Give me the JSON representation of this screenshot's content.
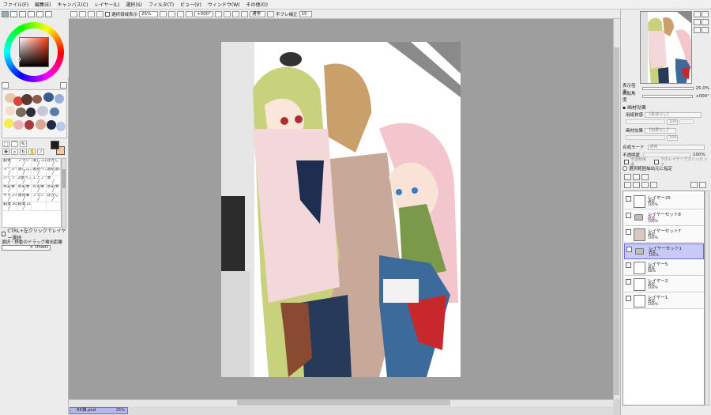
{
  "menu": [
    "ファイル(F)",
    "編集(E)",
    "キャンバス(C)",
    "レイヤー(L)",
    "選択(S)",
    "フィルタ(T)",
    "ビュー(V)",
    "ウィンドウ(W)",
    "その他(O)"
  ],
  "canvas_toolbar": {
    "show_selection_label": "選択領域表示",
    "zoom": "25%",
    "rotation": "+000°",
    "normal_label": "通常",
    "stabilizer_label": "手ブレ補正",
    "stabilizer_value": "15"
  },
  "tools": {
    "brushes": [
      {
        "name": "鉛筆",
        "size": ""
      },
      {
        "name": "ブラシ",
        "size": ""
      },
      {
        "name": "消しゴム",
        "size": ""
      },
      {
        "name": "ぼかし",
        "size": ""
      },
      {
        "name": "マーカー",
        "size": ""
      },
      {
        "name": "消しぶよ",
        "size": ""
      },
      {
        "name": "選択ペン",
        "size": ""
      },
      {
        "name": "選択消し",
        "size": ""
      },
      {
        "name": "バケツ",
        "size": ""
      },
      {
        "name": "2値ペン",
        "size": ""
      },
      {
        "name": "エアブラシ",
        "size": ""
      },
      {
        "name": "筆",
        "size": ""
      },
      {
        "name": "水彩筆",
        "size": "1"
      },
      {
        "name": "水彩筆",
        "size": "100"
      },
      {
        "name": "日本筆",
        "size": ""
      },
      {
        "name": "水彩筆",
        "size": ""
      },
      {
        "name": "キャンバス",
        "size": "1"
      },
      {
        "name": "通常筆",
        "size": "1"
      },
      {
        "name": "ブラシ",
        "size": ""
      },
      {
        "name": "ぼかし",
        "size": ""
      },
      {
        "name": "鉛筆",
        "size": "300"
      },
      {
        "name": "鉛筆",
        "size": "10"
      },
      {
        "name": "",
        "size": ""
      },
      {
        "name": "",
        "size": ""
      }
    ],
    "ctrl_click_label": "CTRL+左クリックでレイヤー選択",
    "drag_threshold_label": "選択・移動のドラッグ検出距離",
    "drag_threshold_value": "± 1Pixels"
  },
  "colors": {
    "foreground": "#201a18",
    "background": "#f2c8a2",
    "workspace": "#9e9e9e"
  },
  "navigator": {
    "zoom_label": "表示倍率",
    "zoom_value": "25.0%",
    "rotation_label": "回転角度",
    "rotation_value": "+000°"
  },
  "texture": {
    "header": "画材効果",
    "paper_label": "用紙質感",
    "paper_value": "【質感なし】",
    "effect_label": "画材効果",
    "effect_value": "【効果なし】",
    "sub_value": "100"
  },
  "layer_props": {
    "blend_label": "合成モード",
    "blend_value": "通常",
    "opacity_label": "不透明度",
    "opacity_value": "100%",
    "preserve_opacity": "不透明保護",
    "clipping": "下のレイヤーでクリッピング",
    "selection_source": "選択範囲抽出元に指定"
  },
  "layers": [
    {
      "name": "レイヤー25",
      "mode": "通常",
      "opacity": "100%",
      "type": "layer",
      "selected": false
    },
    {
      "name": "レイヤーセット8",
      "mode": "通過",
      "opacity": "100%",
      "type": "folder",
      "selected": false
    },
    {
      "name": "レイヤーセット7",
      "mode": "通常",
      "opacity": "100%",
      "type": "set-thumb",
      "selected": false
    },
    {
      "name": "レイヤーセット1",
      "mode": "通常",
      "opacity": "100%",
      "type": "folder",
      "selected": true
    },
    {
      "name": "レイヤー5",
      "mode": "通常",
      "opacity": "68%",
      "type": "layer",
      "selected": false
    },
    {
      "name": "レイヤー2",
      "mode": "通常",
      "opacity": "100%",
      "type": "layer",
      "selected": false
    },
    {
      "name": "レイヤー1",
      "mode": "通常",
      "opacity": "100%",
      "type": "layer",
      "selected": false
    }
  ],
  "document_tab": {
    "filename": "85猫.psd",
    "zoom": "25%"
  }
}
